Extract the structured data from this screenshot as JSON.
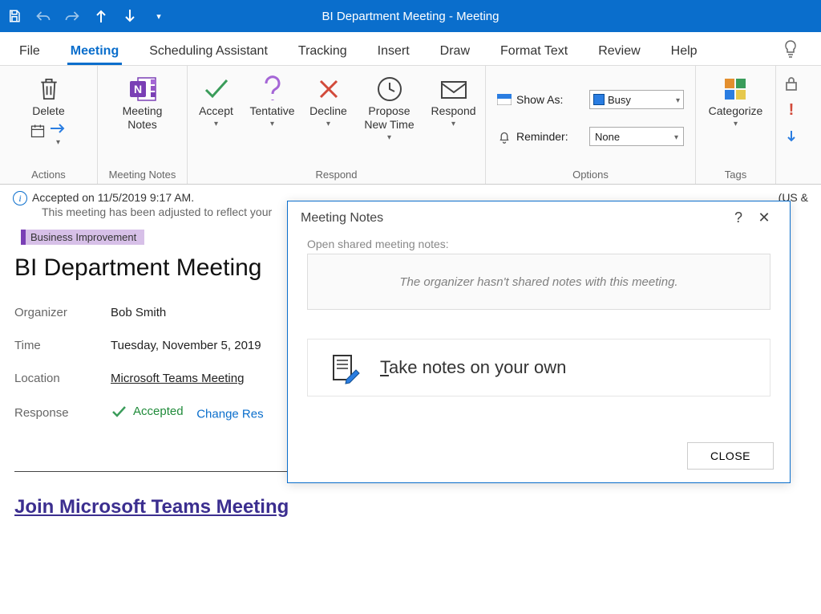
{
  "app_title": "BI Department Meeting  -  Meeting",
  "tabs": {
    "file": "File",
    "meeting": "Meeting",
    "scheduling": "Scheduling Assistant",
    "tracking": "Tracking",
    "insert": "Insert",
    "draw": "Draw",
    "format_text": "Format Text",
    "review": "Review",
    "help": "Help"
  },
  "ribbon": {
    "actions": {
      "delete": "Delete",
      "group": "Actions"
    },
    "meeting_notes": {
      "btn": "Meeting\nNotes",
      "group": "Meeting Notes"
    },
    "respond": {
      "accept": "Accept",
      "tentative": "Tentative",
      "decline": "Decline",
      "propose": "Propose\nNew Time",
      "respond": "Respond",
      "group": "Respond"
    },
    "options": {
      "show_as_label": "Show As:",
      "show_as_value": "Busy",
      "reminder_label": "Reminder:",
      "reminder_value": "None",
      "group": "Options"
    },
    "tags": {
      "categorize": "Categorize",
      "group": "Tags"
    }
  },
  "info": {
    "line1": "Accepted on 11/5/2019 9:17 AM.",
    "line2": "This meeting has been adjusted to reflect your",
    "trail": "(US &"
  },
  "category": "Business Improvement",
  "subject": "BI Department Meeting",
  "fields": {
    "organizer_label": "Organizer",
    "organizer": "Bob Smith",
    "time_label": "Time",
    "time": "Tuesday, November 5, 2019",
    "location_label": "Location",
    "location": "Microsoft Teams Meeting",
    "response_label": "Response",
    "response_val": "Accepted",
    "change": "Change Res"
  },
  "body_link": "Join Microsoft Teams Meeting",
  "dialog": {
    "title": "Meeting Notes",
    "shared_label": "Open shared meeting notes:",
    "shared_msg": "The organizer hasn't shared notes with this meeting.",
    "own_pre": "T",
    "own_rest": "ake notes on your own",
    "close": "CLOSE"
  }
}
